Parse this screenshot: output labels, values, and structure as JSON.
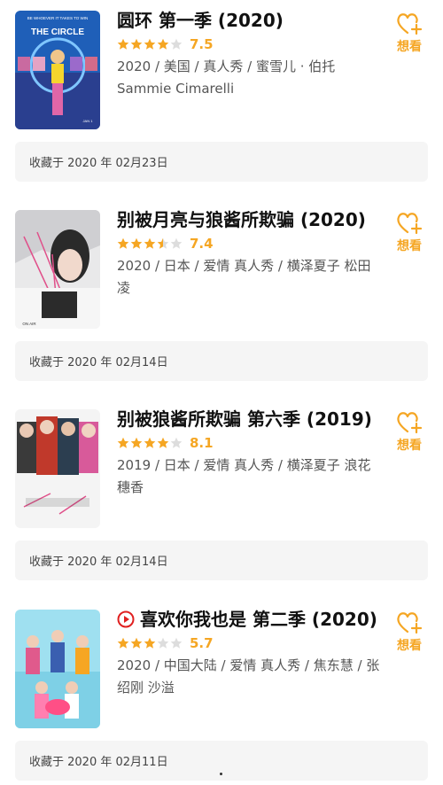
{
  "items": [
    {
      "title": "圆环 第一季 (2020)",
      "rating": 7.5,
      "rating_text": "7.5",
      "meta": "2020 / 美国 / 真人秀 / 蜜雪儿 · 伯托 Sammie Cimarelli",
      "want_label": "想看",
      "collected": "收藏于 2020 年 02月23日",
      "has_play_icon": false,
      "poster_text_top": "BE WHOEVER IT TAKES TO WIN",
      "poster_text_main": "THE CIRCLE",
      "poster_text_date": "JAN 1"
    },
    {
      "title": "别被月亮与狼酱所欺骗 (2020)",
      "rating": 7.4,
      "rating_text": "7.4",
      "meta": "2020 / 日本 / 爱情 真人秀 / 横泽夏子 松田凌",
      "want_label": "想看",
      "collected": "收藏于 2020 年 02月14日",
      "has_play_icon": false,
      "poster_text_bottom": "ON AIR"
    },
    {
      "title": "别被狼酱所欺骗 第六季 (2019)",
      "rating": 8.1,
      "rating_text": "8.1",
      "meta": "2019 / 日本 / 爱情 真人秀 / 横泽夏子 浪花穗香",
      "want_label": "想看",
      "collected": "收藏于 2020 年 02月14日",
      "has_play_icon": false
    },
    {
      "title": "喜欢你我也是 第二季 (2020)",
      "rating": 5.7,
      "rating_text": "5.7",
      "meta": "2020 / 中国大陆 / 爱情 真人秀 / 焦东慧 / 张绍刚 沙溢",
      "want_label": "想看",
      "collected": "收藏于 2020 年 02月11日",
      "has_play_icon": true
    }
  ],
  "colors": {
    "accent": "#f5a623",
    "play": "#e02020",
    "star_empty": "#dddddd"
  }
}
